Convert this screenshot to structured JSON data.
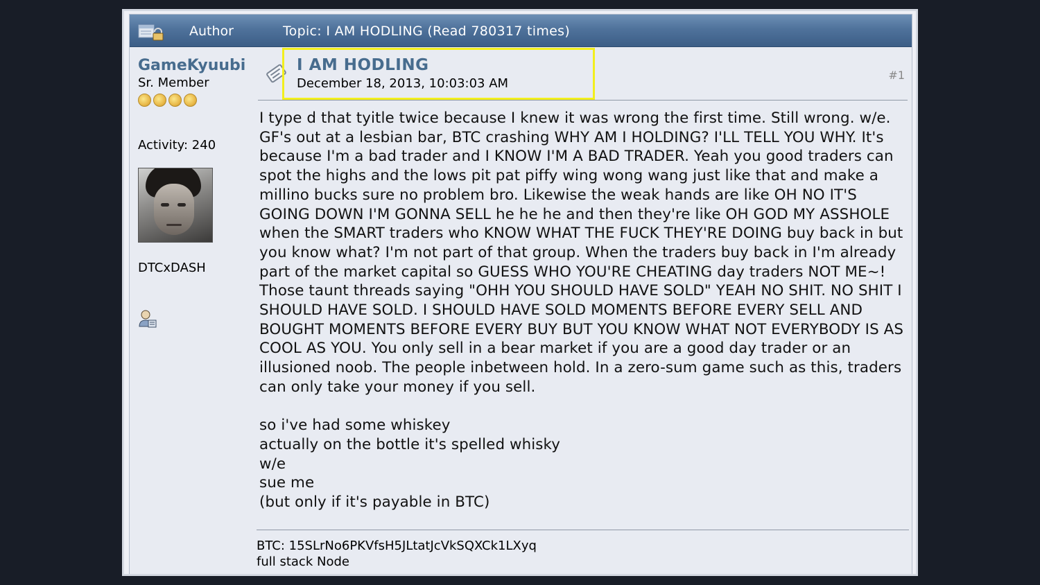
{
  "header": {
    "author_label": "Author",
    "topic_label": "Topic: I AM HODLING  (Read 780317 times)"
  },
  "author": {
    "username": "GameKyuubi",
    "rank": "Sr. Member",
    "star_count": 4,
    "activity": "Activity: 240",
    "personal_text": "DTCxDASH"
  },
  "post": {
    "title": "I AM HODLING",
    "date": "December 18, 2013, 10:03:03 AM",
    "number": "#1",
    "body_paragraph": "I type d that tyitle twice because I knew it was wrong the first time.  Still wrong.  w/e.  GF's out at a lesbian bar, BTC crashing WHY AM I HOLDING? I'LL TELL YOU WHY.  It's because I'm a bad trader and I KNOW I'M A BAD TRADER.  Yeah you good traders can spot the highs and the lows pit pat piffy wing wong wang just like that and make a millino bucks sure no problem bro.  Likewise the weak hands are like OH NO IT'S GOING DOWN I'M GONNA SELL he he he and then they're like OH GOD MY ASSHOLE when the SMART traders who KNOW WHAT THE FUCK THEY'RE DOING buy back in but you know what?  I'm not part of that group.  When the traders buy back in I'm already part of the market capital so GUESS WHO YOU'RE CHEATING day traders NOT ME~!  Those taunt threads saying \"OHH YOU SHOULD HAVE SOLD\" YEAH NO SHIT.  NO SHIT I SHOULD HAVE SOLD.  I SHOULD HAVE SOLD MOMENTS BEFORE EVERY SELL AND BOUGHT MOMENTS BEFORE EVERY BUY BUT YOU KNOW WHAT NOT EVERYBODY IS AS COOL AS YOU.  You only sell in a bear market if you are a good day trader or an illusioned noob.  The people inbetween hold.  In a zero-sum game such as this, traders can only take your money if you sell.",
    "lines": [
      "so i've had some whiskey",
      "actually on the bottle it's spelled whisky",
      "w/e",
      "sue me",
      "(but only if it's payable in BTC)"
    ]
  },
  "signature": {
    "line1": "BTC: 15SLrNo6PKVfsH5JLtatJcVkSQXCk1LXyq",
    "line2": "full stack Node"
  },
  "colors": {
    "header_bar": "#4f729b",
    "link_blue": "#476c8e",
    "highlight": "#f2ef1d",
    "background": "#181d27"
  }
}
